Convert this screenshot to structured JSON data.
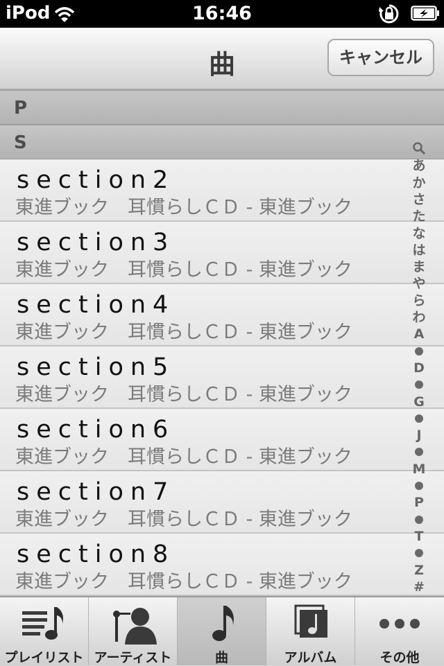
{
  "status_bar": {
    "carrier": "iPod",
    "time": "16:46"
  },
  "nav": {
    "title": "曲",
    "cancel_label": "キャンセル"
  },
  "sections": [
    "P",
    "S"
  ],
  "songs": [
    {
      "title": "section2",
      "subtitle": "東進ブック　耳慣らしＣＤ - 東進ブック"
    },
    {
      "title": "section3",
      "subtitle": "東進ブック　耳慣らしＣＤ - 東進ブック"
    },
    {
      "title": "section4",
      "subtitle": "東進ブック　耳慣らしＣＤ - 東進ブック"
    },
    {
      "title": "section5",
      "subtitle": "東進ブック　耳慣らしＣＤ - 東進ブック"
    },
    {
      "title": "section6",
      "subtitle": "東進ブック　耳慣らしＣＤ - 東進ブック"
    },
    {
      "title": "section7",
      "subtitle": "東進ブック　耳慣らしＣＤ - 東進ブック"
    },
    {
      "title": "section8",
      "subtitle": "東進ブック　耳慣らしＣＤ - 東進ブック"
    }
  ],
  "index": [
    "search-icon",
    "あ",
    "か",
    "さ",
    "た",
    "な",
    "は",
    "ま",
    "や",
    "ら",
    "わ",
    "A",
    "dot",
    "D",
    "dot",
    "G",
    "dot",
    "J",
    "dot",
    "M",
    "dot",
    "P",
    "dot",
    "T",
    "dot",
    "Z",
    "#"
  ],
  "tabs": [
    {
      "label": "プレイリスト",
      "icon": "playlist-icon",
      "selected": false
    },
    {
      "label": "アーティスト",
      "icon": "artist-icon",
      "selected": false
    },
    {
      "label": "曲",
      "icon": "music-note-icon",
      "selected": true
    },
    {
      "label": "アルバム",
      "icon": "album-icon",
      "selected": false
    },
    {
      "label": "その他",
      "icon": "more-icon",
      "selected": false
    }
  ]
}
